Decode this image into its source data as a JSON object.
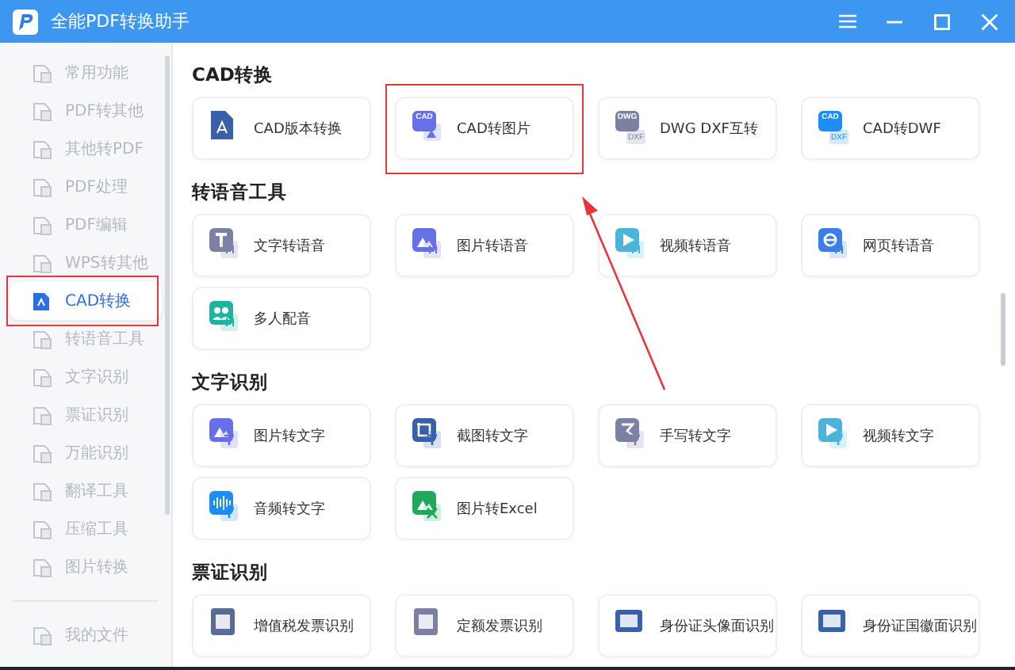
{
  "window": {
    "title": "全能PDF转换助手"
  },
  "sidebar": {
    "items": [
      {
        "label": "常用功能",
        "selected": false
      },
      {
        "label": "PDF转其他",
        "selected": false
      },
      {
        "label": "其他转PDF",
        "selected": false
      },
      {
        "label": "PDF处理",
        "selected": false
      },
      {
        "label": "PDF编辑",
        "selected": false
      },
      {
        "label": "WPS转其他",
        "selected": false
      },
      {
        "label": "CAD转换",
        "selected": true
      },
      {
        "label": "转语音工具",
        "selected": false
      },
      {
        "label": "文字识别",
        "selected": false
      },
      {
        "label": "票证识别",
        "selected": false
      },
      {
        "label": "万能识别",
        "selected": false
      },
      {
        "label": "翻译工具",
        "selected": false
      },
      {
        "label": "压缩工具",
        "selected": false
      },
      {
        "label": "图片转换",
        "selected": false
      }
    ],
    "footer_item": {
      "label": "我的文件",
      "selected": false
    }
  },
  "sections": [
    {
      "title": "CAD转换",
      "cards": [
        {
          "label": "CAD版本转换",
          "kind": "cad-doc",
          "highlighted": false
        },
        {
          "label": "CAD转图片",
          "kind": "badge-image",
          "badge": "CAD",
          "highlighted": true
        },
        {
          "label": "DWG DXF互转",
          "kind": "badge-file",
          "badge": "DWG",
          "sub_badge": "DXF",
          "highlighted": false
        },
        {
          "label": "CAD转DWF",
          "kind": "badge-file-blue",
          "badge": "CAD",
          "sub_badge": "DXF",
          "highlighted": false
        }
      ]
    },
    {
      "title": "转语音工具",
      "cards": [
        {
          "label": "文字转语音",
          "kind": "text-audio"
        },
        {
          "label": "图片转语音",
          "kind": "image-audio"
        },
        {
          "label": "视频转语音",
          "kind": "video-audio"
        },
        {
          "label": "网页转语音",
          "kind": "web-audio"
        },
        {
          "label": "多人配音",
          "kind": "people-audio"
        }
      ]
    },
    {
      "title": "文字识别",
      "cards": [
        {
          "label": "图片转文字",
          "kind": "image-text"
        },
        {
          "label": "截图转文字",
          "kind": "crop-text"
        },
        {
          "label": "手写转文字",
          "kind": "hand-text"
        },
        {
          "label": "视频转文字",
          "kind": "video-text"
        },
        {
          "label": "音频转文字",
          "kind": "audio-text"
        },
        {
          "label": "图片转Excel",
          "kind": "image-excel"
        }
      ]
    },
    {
      "title": "票证识别",
      "cards": [
        {
          "label": "增值税发票识别",
          "kind": "invoice"
        },
        {
          "label": "定额发票识别",
          "kind": "invoice2"
        },
        {
          "label": "身份证头像面识别",
          "kind": "idcard"
        },
        {
          "label": "身份证国徽面识别",
          "kind": "idcard2"
        }
      ]
    }
  ],
  "annotations": {
    "highlight_sidebar": true,
    "arrow": true
  }
}
